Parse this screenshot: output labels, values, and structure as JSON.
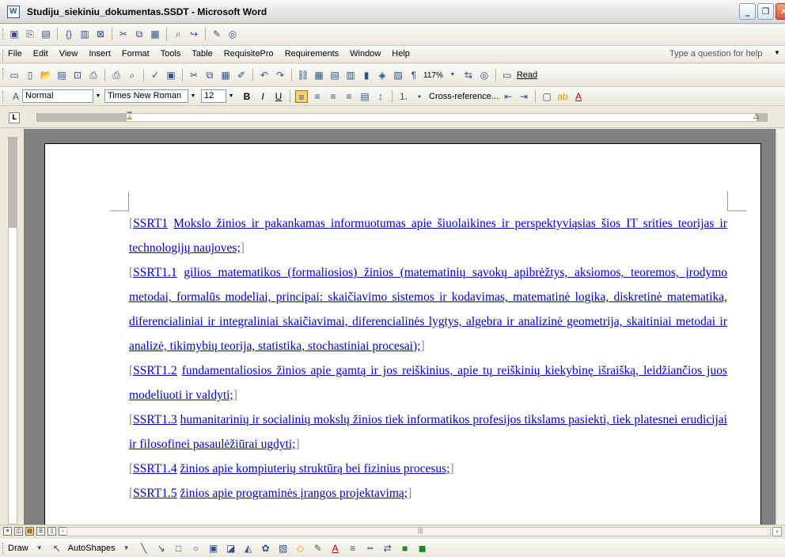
{
  "window": {
    "title": "Studiju_siekiniu_dokumentas.SSDT - Microsoft Word"
  },
  "menu": {
    "items": [
      "File",
      "Edit",
      "View",
      "Insert",
      "Format",
      "Tools",
      "Table",
      "RequisitePro",
      "Requirements",
      "Window",
      "Help"
    ],
    "help_placeholder": "Type a question for help"
  },
  "standard_toolbar": {
    "zoom": "117%",
    "read_label": "Read"
  },
  "format_toolbar": {
    "style": "Normal",
    "font": "Times New Roman",
    "size": "12",
    "cross_reference": "Cross-reference..."
  },
  "document": {
    "paragraphs": [
      {
        "id": "SSRT1",
        "text": "Mokslo žinios ir pakankamas informuotumas apie šiuolaikines ir perspektyviąsias šios IT srities teorijas ir technologijų naujoves;"
      },
      {
        "id": "SSRT1.1",
        "text": "gilios matematikos (formaliosios) žinios (matematinių sąvokų apibrėžtys, aksiomos, teoremos, įrodymo metodai, formalūs modeliai, principai: skaičiavimo sistemos ir kodavimas, matematinė logika, diskretinė matematika, diferencialiniai ir integraliniai skaičiavimai, diferencialinės lygtys, algebra ir analizinė geometrija, skaitiniai metodai ir analizė, tikimybių teorija, statistika, stochastiniai procesai);"
      },
      {
        "id": "SSRT1.2",
        "text": "fundamentaliosios žinios apie gamtą ir jos reiškinius, apie tų reiškinių kiekybinę išraišką, leidžiančios juos modeliuoti ir valdyti;"
      },
      {
        "id": "SSRT1.3",
        "text": "humanitarinių ir socialinių mokslų žinios tiek informatikos profesijos tikslams pasiekti, tiek platesnei erudicijai ir filosofinei pasaulėžiūrai ugdyti;"
      },
      {
        "id": "SSRT1.4",
        "text": "žinios apie kompiuterių struktūrą bei fizinius procesus;"
      },
      {
        "id": "SSRT1.5",
        "text": "žinios apie programinės įrangos projektavimą;"
      }
    ]
  },
  "drawing_toolbar": {
    "draw": "Draw",
    "autoshapes": "AutoShapes"
  },
  "colors": {
    "hyperlink_text": "#0000c8",
    "chrome": "#ece9d8"
  }
}
